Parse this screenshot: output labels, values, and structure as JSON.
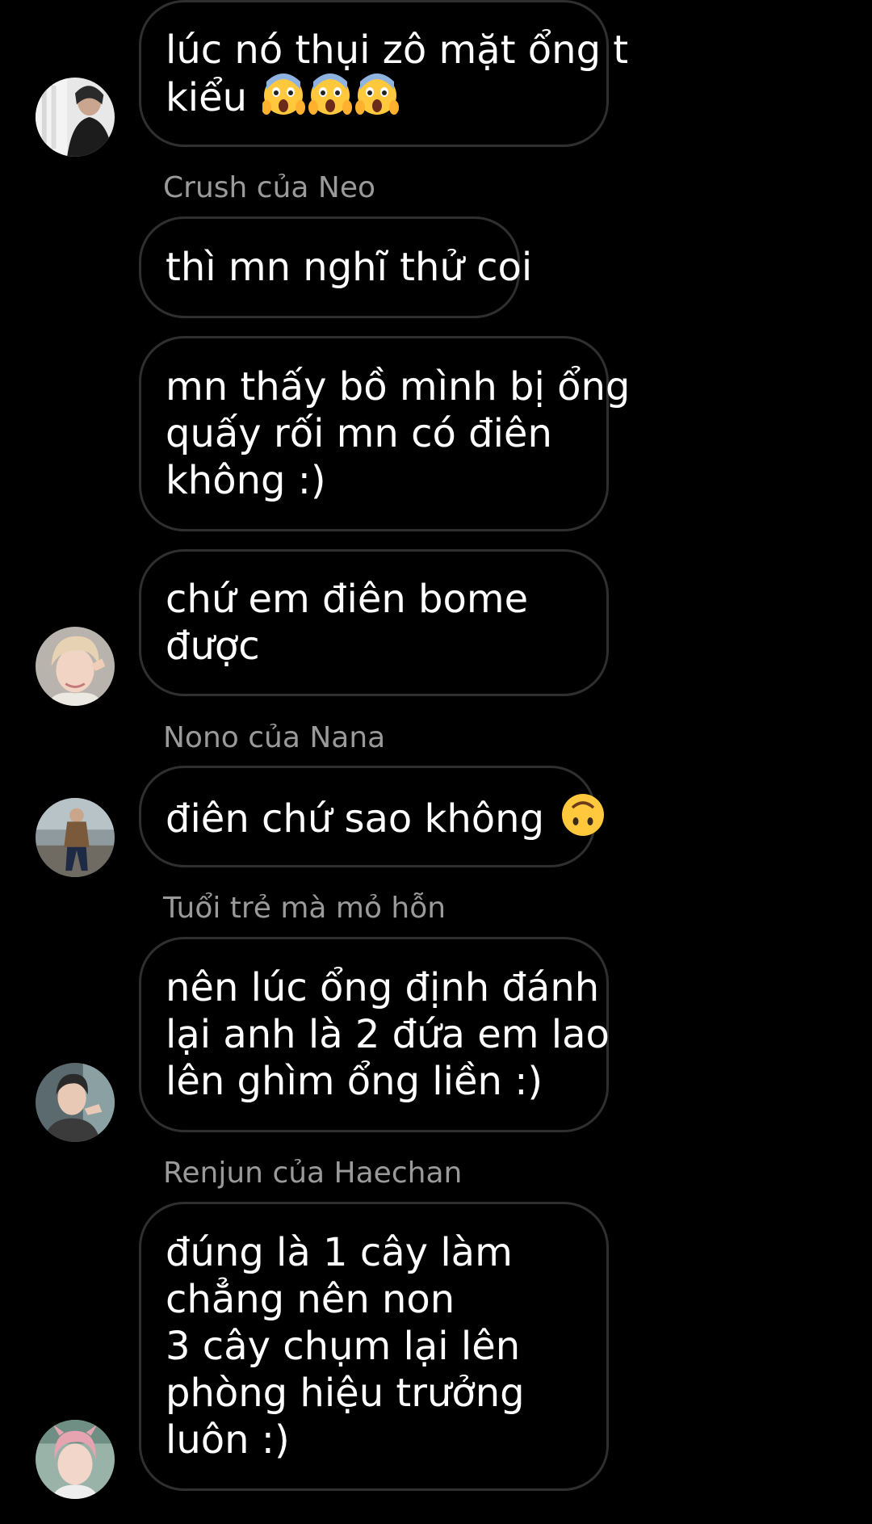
{
  "messages": [
    {
      "lines": [
        "lúc nó thụi zô mặt ổng t",
        "kiểu"
      ],
      "emoji": "face-screaming-in-fear-icon",
      "emoji_count": 3
    },
    {
      "lines": [
        "thì mn nghĩ thử coi"
      ]
    },
    {
      "lines": [
        "mn thấy bồ mình bị ổng",
        "quấy rối mn có điên",
        "không :)"
      ]
    },
    {
      "lines": [
        "chứ em điên bome",
        "được"
      ]
    },
    {
      "lines": [
        "điên chứ sao không"
      ],
      "emoji": "upside-down-face-icon",
      "emoji_count": 1
    },
    {
      "lines": [
        "nên lúc ổng định đánh",
        "lại anh là 2 đứa em lao",
        "lên ghìm ổng liền :)"
      ]
    },
    {
      "lines": [
        "đúng là 1 cây làm",
        "chẳng nên non",
        "3 cây chụm lại lên",
        "phòng hiệu trưởng",
        "luôn :)"
      ]
    }
  ],
  "senders": {
    "crush_cua_neo": "Crush của Neo",
    "nono_cua_nana": "Nono của Nana",
    "tuoi_tre": "Tuổi trẻ mà mỏ hỗn",
    "renjun_cua_haechan": "Renjun của Haechan"
  },
  "avatars": [
    "avatar-photo-1",
    "avatar-photo-2",
    "avatar-photo-3",
    "avatar-photo-4",
    "avatar-photo-5"
  ],
  "colors": {
    "background": "#000000",
    "bubble_border": "#2f2f2f",
    "text": "#ffffff",
    "sender_name": "#9a9a9a"
  }
}
